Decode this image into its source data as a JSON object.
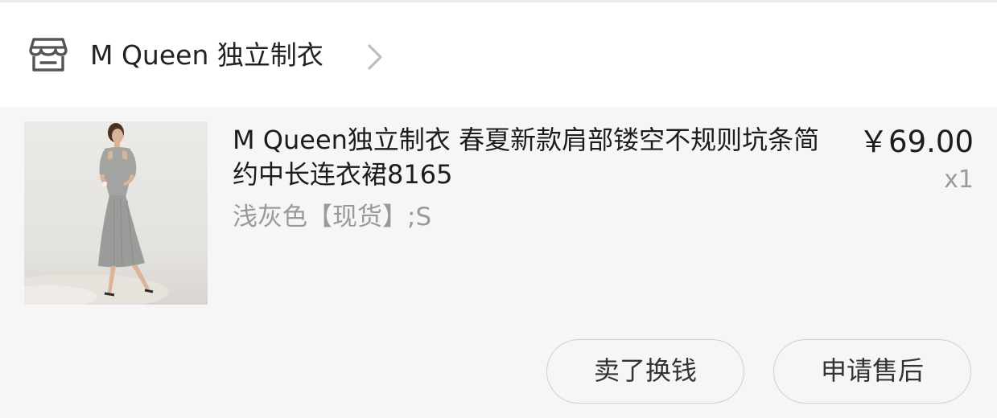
{
  "shop": {
    "name": "M Queen 独立制衣",
    "icon": "store-icon",
    "chevron_icon": "chevron-right-icon"
  },
  "product": {
    "title": "M Queen独立制衣 春夏新款肩部镂空不规则坑条简约中长连衣裙8165",
    "variant": "浅灰色【现货】;S",
    "price": "￥69.00",
    "quantity": "x1",
    "image": "dress-photo"
  },
  "actions": {
    "sell_label": "卖了换钱",
    "aftersale_label": "申请售后"
  }
}
